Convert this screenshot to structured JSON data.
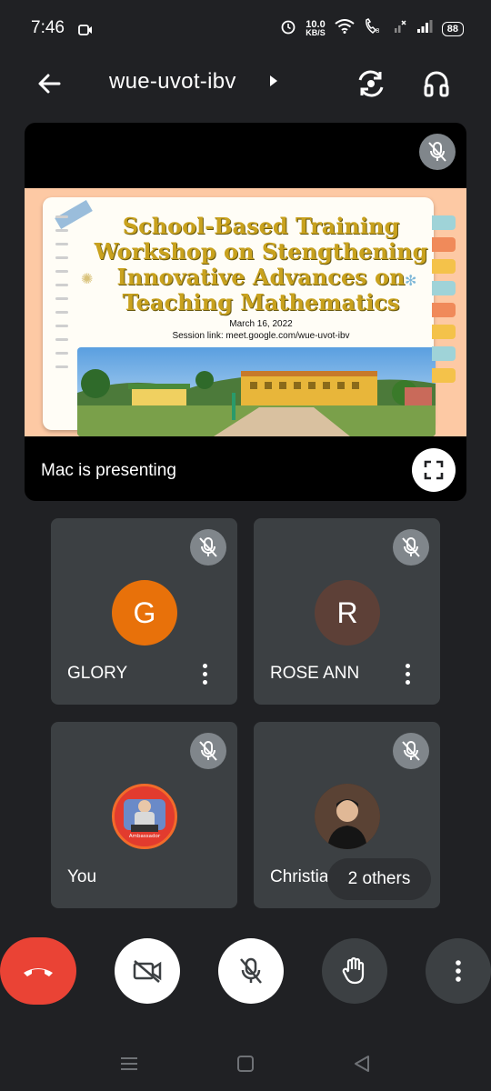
{
  "status_bar": {
    "time": "7:46",
    "net_speed_value": "10.0",
    "net_speed_unit": "KB/S",
    "battery": "88"
  },
  "top_bar": {
    "meeting_code": "wue-uvot-ibv",
    "icons": [
      "back-arrow-icon",
      "caret-right-icon",
      "switch-camera-icon",
      "headphones-icon"
    ]
  },
  "presentation": {
    "slide_title_lines": [
      "School-Based Training",
      "Workshop on Stengthening",
      "Innovative Advances on",
      "Teaching Mathematics"
    ],
    "slide_title_1": "School-Based Training",
    "slide_title_2": "Workshop on Stengthening",
    "slide_title_3": "Innovative Advances on",
    "slide_title_4": "Teaching Mathematics",
    "slide_date": "March 16, 2022",
    "slide_link": "Session link: meet.google.com/wue-uvot-ibv",
    "presenting_label": "Mac is presenting"
  },
  "participants": [
    {
      "name": "GLORY",
      "initial": "G",
      "avatar_color": "#e8710a",
      "muted": true
    },
    {
      "name": "ROSE ANN",
      "initial": "R",
      "avatar_color": "#5d4037",
      "muted": true
    },
    {
      "name": "You",
      "muted": true,
      "avatar_caption": "Ambassador"
    },
    {
      "name": "Christian",
      "muted": true
    }
  ],
  "others_chip": "2 others",
  "controls": [
    "end-call",
    "camera-off",
    "mic-off",
    "raise-hand",
    "more-options"
  ],
  "colors": {
    "background": "#202124",
    "tile": "#3c4043",
    "end_call": "#ea4335"
  }
}
